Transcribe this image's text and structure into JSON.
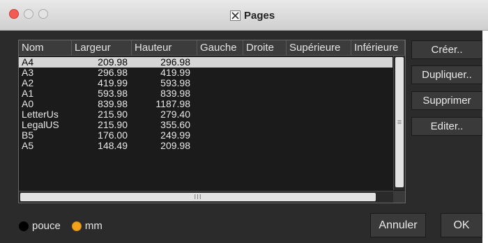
{
  "window": {
    "title": "Pages",
    "icon": "x11-icon"
  },
  "table": {
    "columns": [
      "Nom",
      "Largeur",
      "Hauteur",
      "Gauche",
      "Droite",
      "Supérieure",
      "Inférieure"
    ],
    "rows": [
      {
        "name": "A4",
        "width": "209.98",
        "height": "296.98",
        "selected": true
      },
      {
        "name": "A3",
        "width": "296.98",
        "height": "419.99"
      },
      {
        "name": "A2",
        "width": "419.99",
        "height": "593.98"
      },
      {
        "name": "A1",
        "width": "593.98",
        "height": "839.98"
      },
      {
        "name": "A0",
        "width": "839.98",
        "height": "1187.98"
      },
      {
        "name": "LetterUs",
        "width": "215.90",
        "height": "279.40"
      },
      {
        "name": "LegalUS",
        "width": "215.90",
        "height": "355.60"
      },
      {
        "name": "B5",
        "width": "176.00",
        "height": "249.99"
      },
      {
        "name": "A5",
        "width": "148.49",
        "height": "209.98"
      }
    ],
    "vscroll_grip": "≡",
    "hscroll_grip": "III"
  },
  "side_buttons": {
    "create": "Créer..",
    "duplicate": "Dupliquer..",
    "delete": "Supprimer",
    "edit": "Editer.."
  },
  "units": {
    "inch_label": "pouce",
    "mm_label": "mm",
    "selected": "mm"
  },
  "dialog_buttons": {
    "cancel": "Annuler",
    "ok": "OK"
  },
  "colors": {
    "close_button": "#f25a52",
    "selected_radio": "#f0a21d",
    "background": "#2b2b2b"
  }
}
